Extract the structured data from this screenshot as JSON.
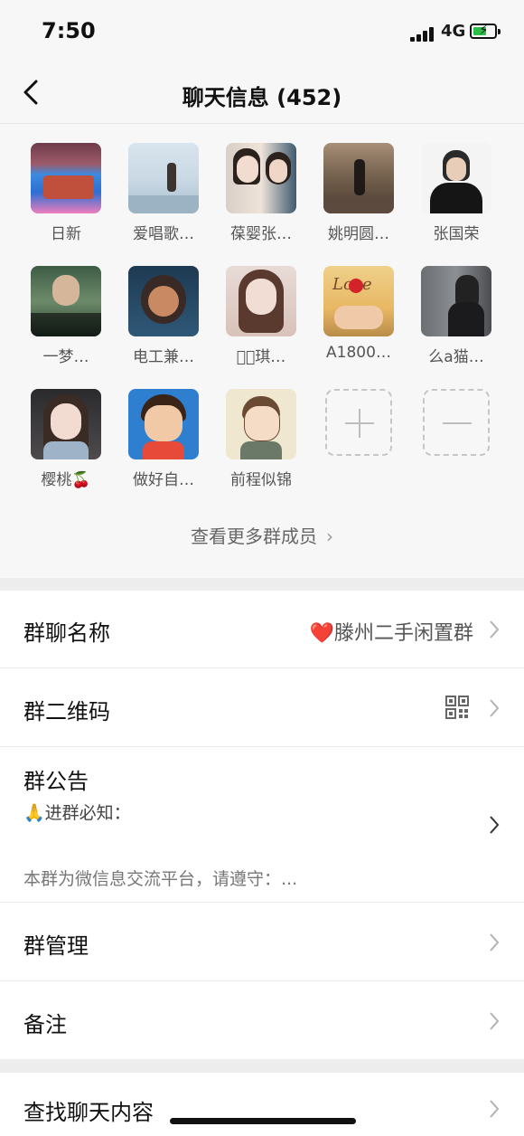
{
  "status": {
    "time": "7:50",
    "network": "4G"
  },
  "nav": {
    "title": "聊天信息 (452)"
  },
  "members": [
    {
      "name": "日新"
    },
    {
      "name": "爱唱歌…"
    },
    {
      "name": "葆婴张…"
    },
    {
      "name": "姚明圆…"
    },
    {
      "name": "张国荣"
    },
    {
      "name": "一梦…"
    },
    {
      "name": "电工兼…"
    },
    {
      "name": "ꩡ⃝琪…"
    },
    {
      "name": "A1800…"
    },
    {
      "name": "么a猫…"
    },
    {
      "name": "樱桃🍒"
    },
    {
      "name": "做好自…"
    },
    {
      "name": "前程似锦"
    }
  ],
  "view_more": "查看更多群成员",
  "settings": {
    "group_name_label": "群聊名称",
    "group_name_value": "❤️滕州二手闲置群",
    "qr_label": "群二维码",
    "notice_label": "群公告",
    "notice_line1": "🙏进群必知：",
    "notice_preview": "本群为微信息交流平台，请遵守：...",
    "manage_label": "群管理",
    "remark_label": "备注",
    "search_label": "查找聊天内容"
  }
}
